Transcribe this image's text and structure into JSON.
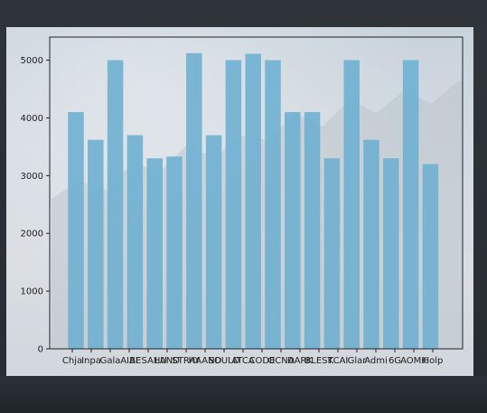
{
  "chart_data": {
    "type": "bar",
    "categories": [
      "Chja",
      "Inpa",
      "Gala",
      "AIAI",
      "BESAHU",
      "LAND",
      "STRAY",
      "HAAND",
      "SOULD",
      "ATCA",
      "CODE",
      "OCNA",
      "DARK",
      "BLEST",
      "KCAI",
      "Glar",
      "Admi",
      "6G",
      "AOMK",
      "Holp"
    ],
    "values": [
      4100,
      3620,
      5000,
      3700,
      3300,
      3330,
      5120,
      3700,
      5000,
      5110,
      5000,
      4100,
      4100,
      3300,
      5000,
      3620,
      3300,
      5000,
      3200
    ],
    "ylim": [
      0,
      5400
    ],
    "yticks": [
      0,
      1000,
      2000,
      3000,
      4000,
      5000
    ],
    "bar_color": "#6fb0d1",
    "grid": false,
    "title": "",
    "xlabel": "",
    "ylabel": ""
  }
}
